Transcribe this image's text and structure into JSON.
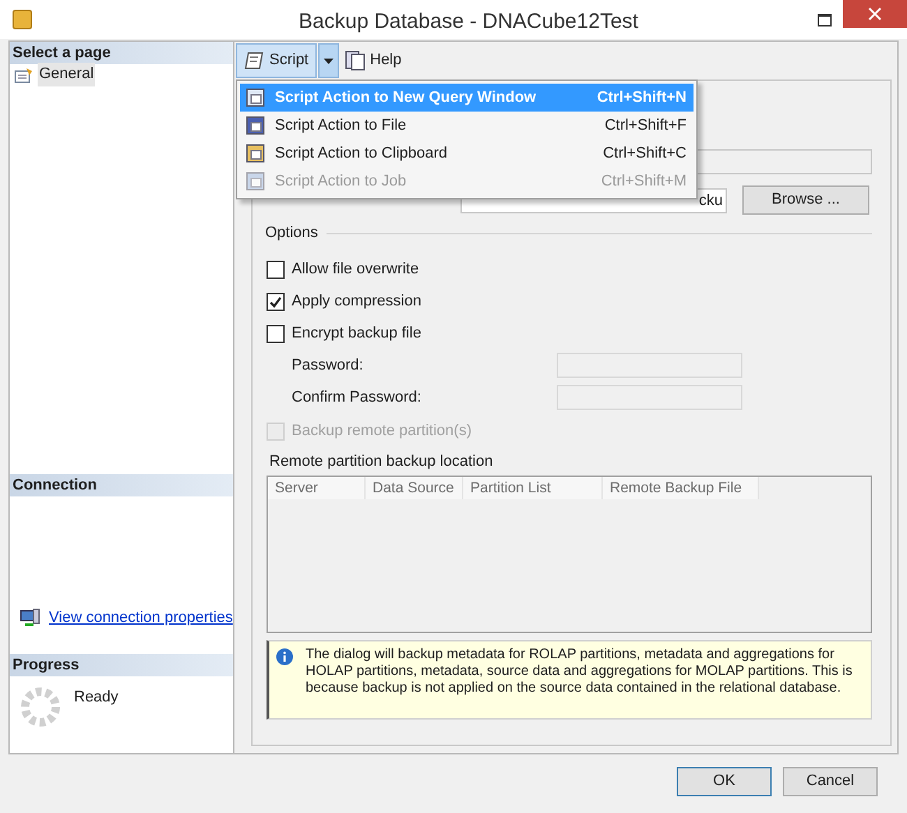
{
  "window": {
    "title": "Backup Database - DNACube12Test"
  },
  "sidebar": {
    "select_header": "Select a page",
    "pages": [
      {
        "label": "General",
        "selected": true
      }
    ],
    "connection_header": "Connection",
    "connection_link": "View connection properties",
    "progress_header": "Progress",
    "progress_status": "Ready"
  },
  "toolbar": {
    "script_button": "Script",
    "help_button": "Help",
    "script_menu_open": true
  },
  "script_menu": [
    {
      "label": "Script Action to New Query Window",
      "shortcut": "Ctrl+Shift+N",
      "selected": true,
      "disabled": false
    },
    {
      "label": "Script Action to File",
      "shortcut": "Ctrl+Shift+F",
      "selected": false,
      "disabled": false
    },
    {
      "label": "Script Action to Clipboard",
      "shortcut": "Ctrl+Shift+C",
      "selected": false,
      "disabled": false
    },
    {
      "label": "Script Action to Job",
      "shortcut": "Ctrl+Shift+M",
      "selected": false,
      "disabled": true
    }
  ],
  "backup_file": {
    "value": "cku",
    "browse_button": "Browse ..."
  },
  "options": {
    "title": "Options",
    "checkboxes": [
      {
        "label": "Allow file overwrite",
        "checked": false,
        "disabled": false
      },
      {
        "label": "Apply compression",
        "checked": true,
        "disabled": false
      },
      {
        "label": "Encrypt backup file",
        "checked": false,
        "disabled": false
      }
    ],
    "fields": [
      {
        "label": "Password:"
      },
      {
        "label": "Confirm Password:"
      }
    ],
    "remote_checkbox": {
      "label": "Backup remote partition(s)",
      "checked": false,
      "disabled": true
    },
    "remote_location_label": "Remote partition backup location",
    "table": {
      "columns": [
        "Server",
        "Data Source",
        "Partition List",
        "Remote Backup File"
      ]
    }
  },
  "info_message": "The dialog will backup metadata for ROLAP partitions, metadata and aggregations for HOLAP partitions, metadata, source data and aggregations for MOLAP partitions. This is because backup is not applied on the source data contained in the relational database.",
  "buttons": [
    {
      "label": "OK",
      "default": true
    },
    {
      "label": "Cancel",
      "default": false
    }
  ]
}
